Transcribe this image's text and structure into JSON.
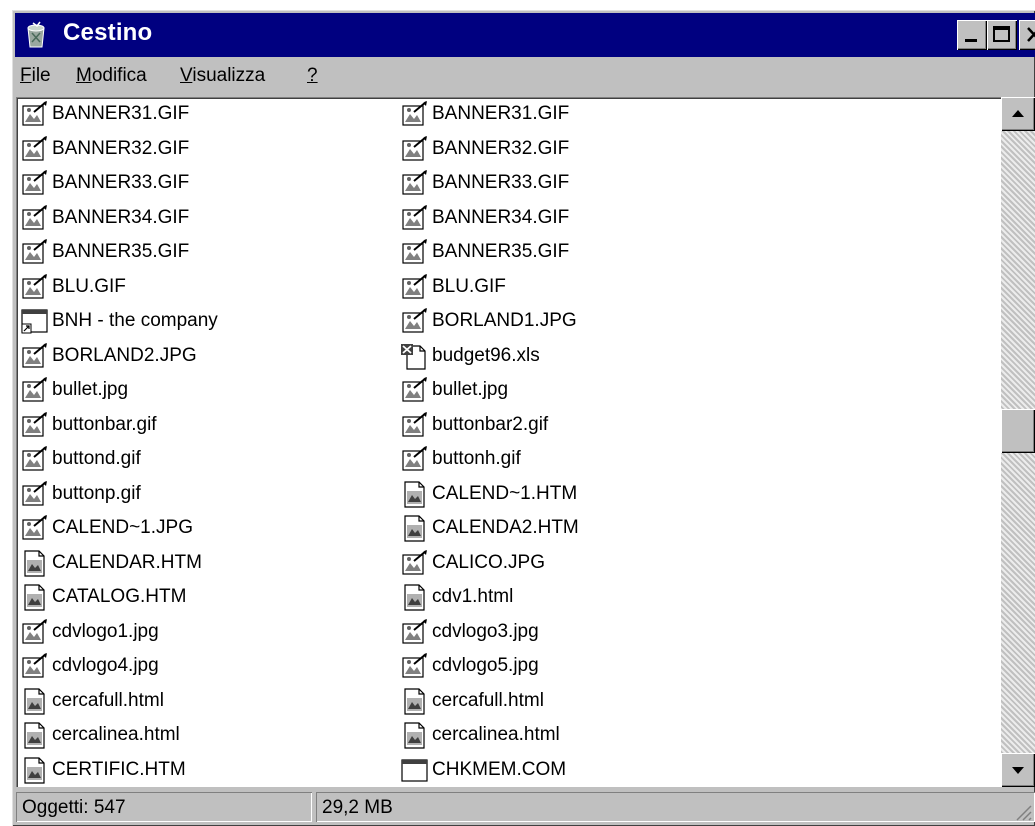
{
  "window": {
    "title": "Cestino",
    "icon": "recycle-bin-icon"
  },
  "menu": [
    {
      "accel": "F",
      "rest": "ile"
    },
    {
      "accel": "M",
      "rest": "odifica"
    },
    {
      "accel": "V",
      "rest": "isualizza"
    },
    {
      "accel": "?",
      "rest": ""
    }
  ],
  "files": {
    "left": [
      {
        "name": "BANNER31.GIF",
        "icon": "image-icon"
      },
      {
        "name": "BANNER32.GIF",
        "icon": "image-icon"
      },
      {
        "name": "BANNER33.GIF",
        "icon": "image-icon"
      },
      {
        "name": "BANNER34.GIF",
        "icon": "image-icon"
      },
      {
        "name": "BANNER35.GIF",
        "icon": "image-icon"
      },
      {
        "name": "BLU.GIF",
        "icon": "image-icon"
      },
      {
        "name": "BNH - the company",
        "icon": "shortcut-icon"
      },
      {
        "name": "BORLAND2.JPG",
        "icon": "image-icon"
      },
      {
        "name": "bullet.jpg",
        "icon": "image-icon"
      },
      {
        "name": "buttonbar.gif",
        "icon": "image-icon"
      },
      {
        "name": "buttond.gif",
        "icon": "image-icon"
      },
      {
        "name": "buttonp.gif",
        "icon": "image-icon"
      },
      {
        "name": "CALEND~1.JPG",
        "icon": "image-icon"
      },
      {
        "name": "CALENDAR.HTM",
        "icon": "html-document-icon"
      },
      {
        "name": "CATALOG.HTM",
        "icon": "html-document-icon"
      },
      {
        "name": "cdvlogo1.jpg",
        "icon": "image-icon"
      },
      {
        "name": "cdvlogo4.jpg",
        "icon": "image-icon"
      },
      {
        "name": "cercafull.html",
        "icon": "html-document-icon"
      },
      {
        "name": "cercalinea.html",
        "icon": "html-document-icon"
      },
      {
        "name": "CERTIFIC.HTM",
        "icon": "html-document-icon"
      }
    ],
    "right": [
      {
        "name": "BANNER31.GIF",
        "icon": "image-icon"
      },
      {
        "name": "BANNER32.GIF",
        "icon": "image-icon"
      },
      {
        "name": "BANNER33.GIF",
        "icon": "image-icon"
      },
      {
        "name": "BANNER34.GIF",
        "icon": "image-icon"
      },
      {
        "name": "BANNER35.GIF",
        "icon": "image-icon"
      },
      {
        "name": "BLU.GIF",
        "icon": "image-icon"
      },
      {
        "name": "BORLAND1.JPG",
        "icon": "image-icon"
      },
      {
        "name": "budget96.xls",
        "icon": "excel-document-icon"
      },
      {
        "name": "bullet.jpg",
        "icon": "image-icon"
      },
      {
        "name": "buttonbar2.gif",
        "icon": "image-icon"
      },
      {
        "name": "buttonh.gif",
        "icon": "image-icon"
      },
      {
        "name": "CALEND~1.HTM",
        "icon": "html-document-icon"
      },
      {
        "name": "CALENDA2.HTM",
        "icon": "html-document-icon"
      },
      {
        "name": "CALICO.JPG",
        "icon": "image-icon"
      },
      {
        "name": "cdv1.html",
        "icon": "html-document-icon"
      },
      {
        "name": "cdvlogo3.jpg",
        "icon": "image-icon"
      },
      {
        "name": "cdvlogo5.jpg",
        "icon": "image-icon"
      },
      {
        "name": "cercafull.html",
        "icon": "html-document-icon"
      },
      {
        "name": "cercalinea.html",
        "icon": "html-document-icon"
      },
      {
        "name": "CHKMEM.COM",
        "icon": "program-icon"
      }
    ]
  },
  "status": {
    "objects": "Oggetti: 547",
    "size": "29,2 MB"
  },
  "colors": {
    "titlebar": "#000080",
    "chrome": "#c0c0c0"
  }
}
